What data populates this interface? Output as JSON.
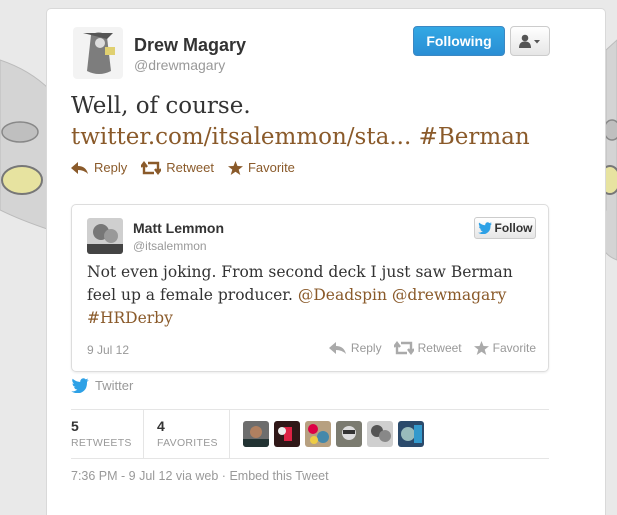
{
  "author": {
    "name": "Drew Magary",
    "handle": "@drewmagary",
    "following_label": "Following"
  },
  "tweet": {
    "line1": "Well, of course.",
    "link": "twitter.com/itsalemmon/sta...",
    "hashtag": "#Berman"
  },
  "actions": {
    "reply": "Reply",
    "retweet": "Retweet",
    "favorite": "Favorite"
  },
  "embedded": {
    "name": "Matt Lemmon",
    "handle": "@itsalemmon",
    "follow_label": "Follow",
    "text_before": "Not even joking. From second deck I just saw Berman feel up a female producer. ",
    "mention1": "@Deadspin",
    "mention2": "@drewmagary",
    "hashtag": "#HRDerby",
    "date": "9 Jul 12"
  },
  "twitter_label": "Twitter",
  "stats": {
    "retweets": {
      "count": "5",
      "label": "RETWEETS"
    },
    "favorites": {
      "count": "4",
      "label": "FAVORITES"
    }
  },
  "footer": {
    "timestamp": "7:36 PM - 9 Jul 12 via web",
    "separator": "·",
    "embed_link": "Embed this Tweet"
  },
  "colors": {
    "link": "#8a5a2a",
    "follow_blue": "#2a8ed4",
    "twitter_bird": "#2ea1e6"
  }
}
